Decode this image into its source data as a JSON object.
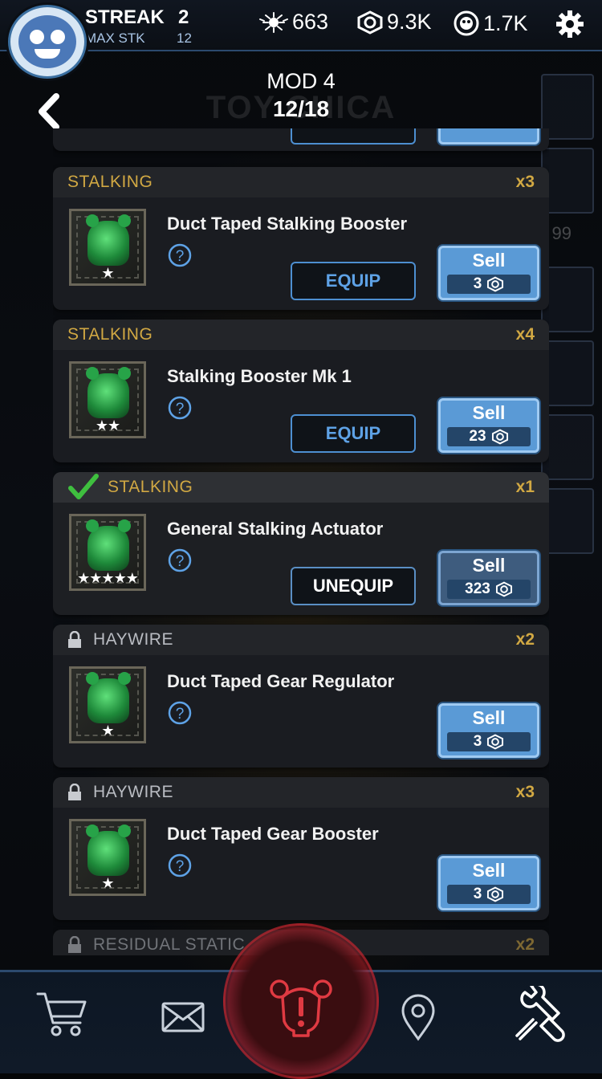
{
  "topbar": {
    "streak_label": "STREAK",
    "streak_value": "2",
    "maxstk_label": "MAX STK",
    "maxstk_value": "12",
    "remnant": "663",
    "parts": "9.3K",
    "tokens": "1.7K",
    "icons": [
      "avatar",
      "remnant-icon",
      "parts-icon",
      "faz-token-icon",
      "gear-icon"
    ]
  },
  "header": {
    "mod_title": "MOD 4",
    "mod_count": "12/18",
    "background_title": "TOY CHICA"
  },
  "side_number": "99",
  "cards": [
    {
      "category": "STALKING",
      "qty": "x3",
      "name": "Duct Taped Stalking Booster",
      "stars": "★",
      "button": "EQUIP",
      "sell_label": "Sell",
      "sell_price": "3",
      "equipped": false,
      "locked": false
    },
    {
      "category": "STALKING",
      "qty": "x4",
      "name": "Stalking Booster Mk 1",
      "stars": "★★",
      "button": "EQUIP",
      "sell_label": "Sell",
      "sell_price": "23",
      "equipped": false,
      "locked": false
    },
    {
      "category": "STALKING",
      "qty": "x1",
      "name": "General Stalking Actuator",
      "stars": "★★★★★",
      "button": "UNEQUIP",
      "sell_label": "Sell",
      "sell_price": "323",
      "equipped": true,
      "locked": false
    },
    {
      "category": "HAYWIRE",
      "qty": "x2",
      "name": "Duct Taped Gear Regulator",
      "stars": "★",
      "button": "",
      "sell_label": "Sell",
      "sell_price": "3",
      "equipped": false,
      "locked": true
    },
    {
      "category": "HAYWIRE",
      "qty": "x3",
      "name": "Duct Taped Gear Booster",
      "stars": "★",
      "button": "",
      "sell_label": "Sell",
      "sell_price": "3",
      "equipped": false,
      "locked": true
    },
    {
      "category": "RESIDUAL STATIC",
      "qty": "x2",
      "locked": true
    }
  ],
  "nav": {
    "items": [
      "shop-icon",
      "inbox-icon",
      "alarm-icon",
      "map-pin-icon",
      "workshop-icon"
    ]
  },
  "colors": {
    "accent_gold": "#d1a843",
    "accent_blue": "#5ea2e6",
    "sell_blue": "#5a9ad6",
    "check_green": "#3fbf3f",
    "alarm_red": "#d22a32"
  }
}
